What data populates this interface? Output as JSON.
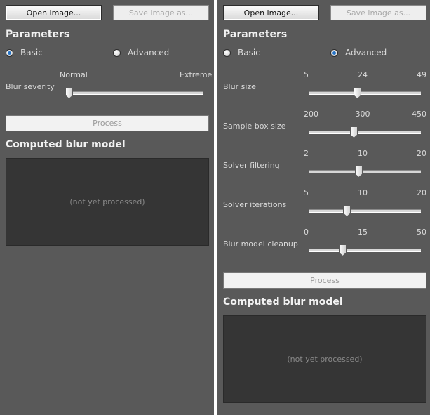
{
  "basic": {
    "open_label": "Open image...",
    "save_label": "Save image as...",
    "parameters_title": "Parameters",
    "mode_basic": "Basic",
    "mode_advanced": "Advanced",
    "selected_mode": "Basic",
    "blur_severity": {
      "label": "Blur severity",
      "min_label": "Normal",
      "max_label": "Extreme",
      "value_fraction": 0.0
    },
    "process_label": "Process",
    "result_title": "Computed blur model",
    "result_text": "(not yet processed)"
  },
  "advanced": {
    "open_label": "Open image...",
    "save_label": "Save image as...",
    "parameters_title": "Parameters",
    "mode_basic": "Basic",
    "mode_advanced": "Advanced",
    "selected_mode": "Advanced",
    "params": [
      {
        "label": "Blur size",
        "min": "5",
        "mid": "24",
        "max": "49",
        "value": 24
      },
      {
        "label": "Sample box size",
        "min": "200",
        "mid": "300",
        "max": "450",
        "value": 300
      },
      {
        "label": "Solver filtering",
        "min": "2",
        "mid": "10",
        "max": "20",
        "value": 10
      },
      {
        "label": "Solver iterations",
        "min": "5",
        "mid": "10",
        "max": "20",
        "value": 10
      },
      {
        "label": "Blur model cleanup",
        "min": "0",
        "mid": "15",
        "max": "50",
        "value": 15
      }
    ],
    "process_label": "Process",
    "result_title": "Computed blur model",
    "result_text": "(not yet processed)"
  },
  "colors": {
    "panel_bg": "#595959",
    "radio_accent": "#2573c6",
    "result_bg": "#353535"
  }
}
